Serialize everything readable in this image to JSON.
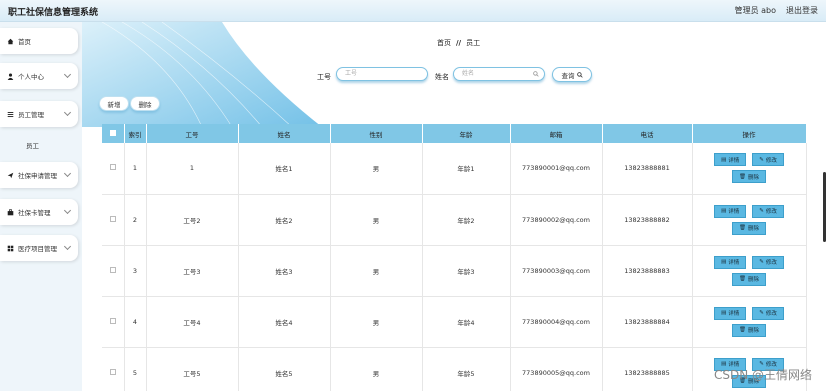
{
  "header": {
    "title": "职工社保信息管理系统",
    "user": "管理员 abo",
    "logout": "退出登录"
  },
  "sidebar": {
    "items": [
      {
        "label": "首页"
      },
      {
        "label": "个人中心"
      },
      {
        "label": "员工管理"
      },
      {
        "label": "社保申请管理"
      },
      {
        "label": "社保卡管理"
      },
      {
        "label": "医疗项目管理"
      }
    ],
    "sub": {
      "label": "员工"
    }
  },
  "breadcrumb": {
    "home": "首页",
    "sep": "//",
    "current": "员工"
  },
  "search": {
    "id_label": "工号",
    "id_placeholder": "工号",
    "name_label": "姓名",
    "name_placeholder": "姓名",
    "query": "查询"
  },
  "actions": {
    "add": "新增",
    "delete": "删除"
  },
  "table": {
    "headers": [
      "索引",
      "工号",
      "姓名",
      "性别",
      "年龄",
      "邮箱",
      "电话",
      "操作"
    ],
    "ops": {
      "detail": "详情",
      "edit": "修改",
      "delete": "删除"
    },
    "rows": [
      {
        "idx": "1",
        "id": "1",
        "name": "姓名1",
        "gender": "男",
        "age": "年龄1",
        "email": "773890001@qq.com",
        "phone": "13823888881"
      },
      {
        "idx": "2",
        "id": "工号2",
        "name": "姓名2",
        "gender": "男",
        "age": "年龄2",
        "email": "773890002@qq.com",
        "phone": "13823888882"
      },
      {
        "idx": "3",
        "id": "工号3",
        "name": "姓名3",
        "gender": "男",
        "age": "年龄3",
        "email": "773890003@qq.com",
        "phone": "13823888883"
      },
      {
        "idx": "4",
        "id": "工号4",
        "name": "姓名4",
        "gender": "男",
        "age": "年龄4",
        "email": "773890004@qq.com",
        "phone": "13823888884"
      },
      {
        "idx": "5",
        "id": "工号5",
        "name": "姓名5",
        "gender": "男",
        "age": "年龄5",
        "email": "773890005@qq.com",
        "phone": "13823888885"
      }
    ]
  },
  "watermark": "CSDN @王倩网络",
  "colors": {
    "accent": "#80c7e6",
    "button": "#5ab8e2"
  }
}
